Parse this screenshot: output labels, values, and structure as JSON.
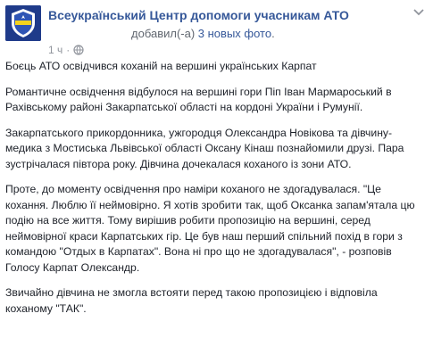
{
  "post": {
    "page_name": "Всеукраїнський Центр допомоги учасникам АТО",
    "action_prefix": "добавил(-а) ",
    "action_link": "3 новых фото",
    "action_suffix": ".",
    "timestamp": "1 ч",
    "separator": "·",
    "privacy_icon": "globe-icon",
    "menu_icon": "chevron-down-icon",
    "avatar_icon": "organization-logo",
    "paragraphs": [
      "Боєць АТО освідчився коханій на вершині українських Карпат",
      "Романтичне освідчення відбулося на вершині гори Піп Іван Мармароський в Рахівському районі Закарпатської області на кордоні України і Румунії.",
      "Закарпатського прикордонника, ужгородця Олександра Новікова та дівчину-медика з Мостиська Львівської області Оксану Кінаш познайомили друзі. Пара зустрічалася півтора року. Дівчина дочекалася коханого із зони АТО.",
      "Проте, до моменту освідчення про наміри коханого не здогадувалася. \"Це кохання. Люблю її неймовірно. Я хотів зробити так, щоб Оксанка запам'ятала цю подію на все життя. Тому вирішив робити пропозицію на вершині, серед неймовірної краси Карпатських гір. Це був наш перший спільний похід в гори з командою \"Отдых в Карпатах\". Вона ні про що не здогадувалася\", - розповів Голосу Карпат Олександр.",
      "Звичайно дівчина не змогла встояти перед такою пропозицією і відповіла коханому \"ТАК\"."
    ]
  },
  "colors": {
    "link": "#365899",
    "meta": "#90949c",
    "text": "#1d2129",
    "avatar_bg": "#1f3b8a"
  }
}
